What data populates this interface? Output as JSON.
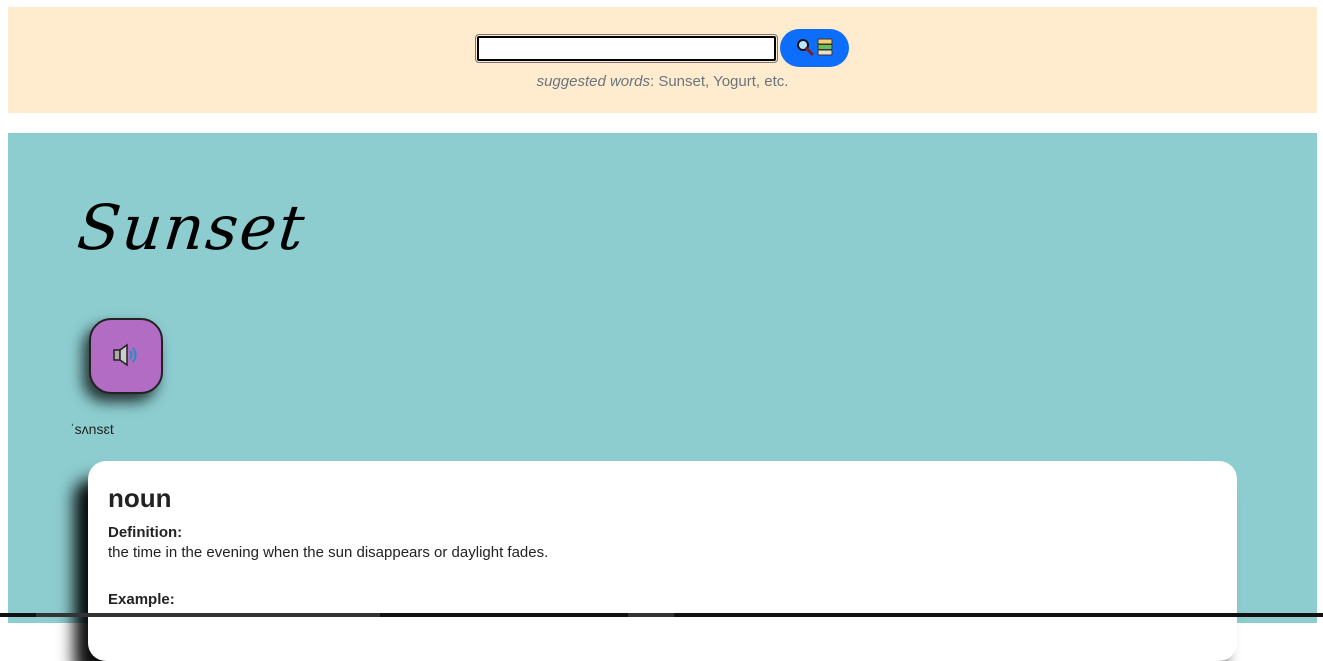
{
  "search": {
    "value": "",
    "button_icons": [
      "magnifier-icon",
      "books-icon"
    ],
    "hint_label": "suggested words",
    "hint_words": ": Sunset, Yogurt, etc."
  },
  "entry": {
    "word": "Sunset",
    "audio_icon": "speaker-icon",
    "phonetic": "ˈsʌnsɛt",
    "meanings": [
      {
        "part_of_speech": "noun",
        "definition_label": "Definition:",
        "definition": "the time in the evening when the sun disappears or daylight fades.",
        "example_label": "Example:"
      }
    ]
  },
  "colors": {
    "header_bg": "#ffebcd",
    "result_bg": "#8dcdd0",
    "search_button": "#0d6efd",
    "audio_button": "#b36cc4"
  }
}
